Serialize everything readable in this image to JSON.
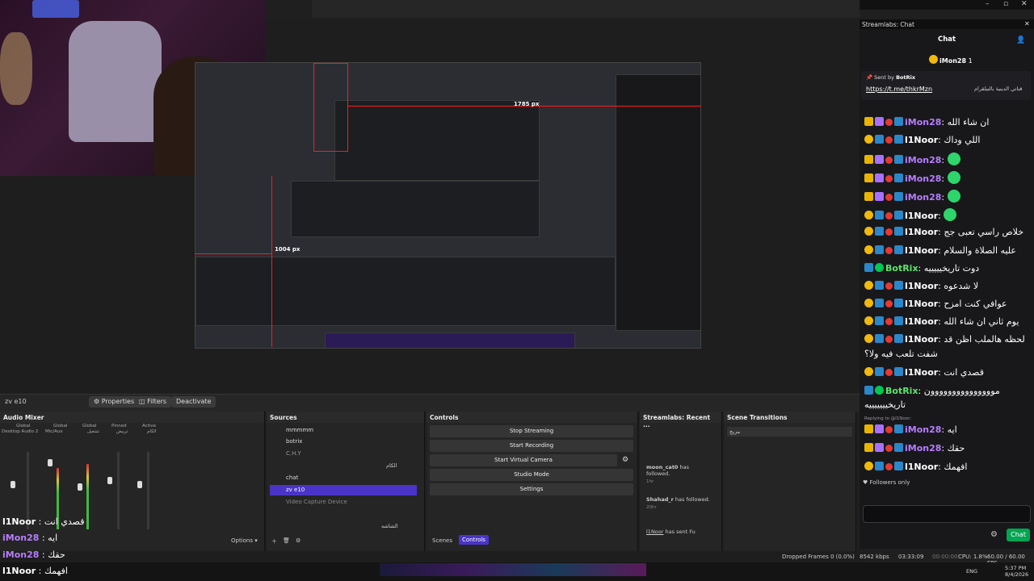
{
  "preview": {
    "px_label_top": "1785 px",
    "px_label_left": "1004 px"
  },
  "dock": {
    "source_name": "zv e10",
    "properties": "Properties",
    "filters": "Filters",
    "deactivate": "Deactivate"
  },
  "audio_mixer": {
    "title": "Audio Mixer",
    "columns": [
      {
        "group": "Global",
        "name": "Desktop Audio 2"
      },
      {
        "group": "Global",
        "name": "Mic/Aux"
      },
      {
        "group": "Global",
        "name": "تشغيل"
      },
      {
        "group": "Pinned",
        "name": "تريبض"
      },
      {
        "group": "Active",
        "name": "الكام"
      }
    ]
  },
  "sources": {
    "title": "Sources",
    "items": [
      {
        "name": "mmmmm"
      },
      {
        "name": "botrix"
      },
      {
        "name": "C.H.Y"
      },
      {
        "name": ""
      },
      {
        "name": "chat"
      },
      {
        "name": "zv e10"
      },
      {
        "name": "Video Capture Device"
      },
      {
        "name": ""
      },
      {
        "name": ""
      }
    ],
    "row_right_label": "الكام",
    "row_right_label2": "الشاشه"
  },
  "controls": {
    "title": "Controls",
    "stop_streaming": "Stop Streaming",
    "start_recording": "Start Recording",
    "start_virtual_camera": "Start Virtual Camera",
    "studio_mode": "Studio Mode",
    "settings": "Settings",
    "tab_scenes": "Scenes",
    "tab_controls": "Controls"
  },
  "recent_events": {
    "title": "Streamlabs: Recent ...",
    "events": [
      {
        "user": "moon_cat0",
        "action": "has followed.",
        "time": "1hr"
      },
      {
        "user": "Shahad_r",
        "action": "has followed.",
        "time": "20hr"
      },
      {
        "user": "l1Noor",
        "action": "has sent Fu",
        "time": ""
      }
    ]
  },
  "scene_transitions": {
    "title": "Scene Transitions",
    "selected": "مزيج"
  },
  "mixer_options": "Options",
  "status": {
    "dropped": "Dropped Frames 0 (0.0%)",
    "kbps": "8542 kbps",
    "live_time": "03:33:09",
    "rec_time": "00:00:00",
    "cpu": "CPU: 1.8%",
    "fps": "60.00 / 60.00 FPS"
  },
  "chat": {
    "window_title": "Streamlabs: Chat",
    "header": "Chat",
    "pinned_user": "iMon28",
    "pinned_count": "1",
    "sent_by": "Sent by",
    "sent_by_user": "BotRix",
    "pinned_link": "https://t.me/thkrMzn",
    "pinned_text": "قناتي الدينية بالتيلقرام",
    "messages": [
      {
        "user": "iMon28",
        "color": "purple",
        "text": "ان شاء الله",
        "badges": [
          "crown",
          "sub",
          "red",
          "blue"
        ]
      },
      {
        "user": "l1Noor",
        "color": "white",
        "text": "اللي وداك",
        "badges": [
          "circ",
          "blue",
          "red",
          "blue"
        ]
      },
      {
        "user": "iMon28",
        "color": "purple",
        "text": "",
        "emote": true,
        "badges": [
          "crown",
          "sub",
          "red",
          "blue"
        ]
      },
      {
        "user": "iMon28",
        "color": "purple",
        "text": "",
        "emote": true,
        "badges": [
          "crown",
          "sub",
          "red",
          "blue"
        ]
      },
      {
        "user": "iMon28",
        "color": "purple",
        "text": "",
        "emote": true,
        "badges": [
          "crown",
          "sub",
          "red",
          "blue"
        ]
      },
      {
        "user": "l1Noor",
        "color": "white",
        "text": "",
        "emote": true,
        "badges": [
          "circ",
          "blue",
          "red",
          "blue"
        ]
      },
      {
        "user": "l1Noor",
        "color": "white",
        "text": "خلاص راسي تعبى جج",
        "badges": [
          "circ",
          "blue",
          "red",
          "blue"
        ],
        "prefix": true
      },
      {
        "user": "l1Noor",
        "color": "white",
        "text": "عليه الصلاة والسلام",
        "badges": [
          "circ",
          "blue",
          "red",
          "blue"
        ]
      },
      {
        "user": "BotRix",
        "color": "green",
        "text": "دوت تاريخيييييه",
        "badges": [
          "blue",
          "green"
        ]
      },
      {
        "user": "l1Noor",
        "color": "white",
        "text": "لا شدعوه",
        "badges": [
          "circ",
          "blue",
          "red",
          "blue"
        ]
      },
      {
        "user": "l1Noor",
        "color": "white",
        "text": "عوافي كنت امزح",
        "badges": [
          "circ",
          "blue",
          "red",
          "blue"
        ]
      },
      {
        "user": "l1Noor",
        "color": "white",
        "text": "يوم ثاني ان شاء الله",
        "badges": [
          "circ",
          "blue",
          "red",
          "blue"
        ]
      },
      {
        "user": "l1Noor",
        "color": "white",
        "text": "لحظه هالملب اظن قد",
        "badges": [
          "circ",
          "blue",
          "red",
          "blue"
        ]
      },
      {
        "user": "",
        "color": "white",
        "text": "شفت تلعب فيه ولا؟",
        "badges": []
      },
      {
        "user": "l1Noor",
        "color": "white",
        "text": "قصدي انت",
        "badges": [
          "circ",
          "blue",
          "red",
          "blue"
        ]
      },
      {
        "user": "BotRix",
        "color": "green",
        "text": "مووووووووووووووون",
        "badges": [
          "blue",
          "green"
        ]
      },
      {
        "user": "",
        "color": "white",
        "text": "تاريخيييييييه",
        "badges": []
      },
      {
        "user": "iMon28",
        "color": "purple",
        "text": "ايه",
        "badges": [
          "crown",
          "sub",
          "red",
          "blue"
        ]
      },
      {
        "user": "iMon28",
        "color": "purple",
        "text": "حقك",
        "badges": [
          "crown",
          "sub",
          "red",
          "blue"
        ]
      },
      {
        "user": "l1Noor",
        "color": "white",
        "text": "افهمك",
        "badges": [
          "circ",
          "blue",
          "red",
          "blue"
        ]
      }
    ],
    "replying_to": "Replying to @l1Noor:",
    "followers_only": "Followers only",
    "chat_button": "Chat"
  },
  "overlay_chat": [
    {
      "user": "l1Noor",
      "text": "قصدي انت"
    },
    {
      "user": "iMon28",
      "text": "ايه"
    },
    {
      "user": "iMon28",
      "text": "حقك"
    },
    {
      "user": "l1Noor",
      "text": "افهمك"
    }
  ],
  "taskbar": {
    "lang": "ENG",
    "time": "5:37 PM",
    "date": "8/4/2026"
  }
}
